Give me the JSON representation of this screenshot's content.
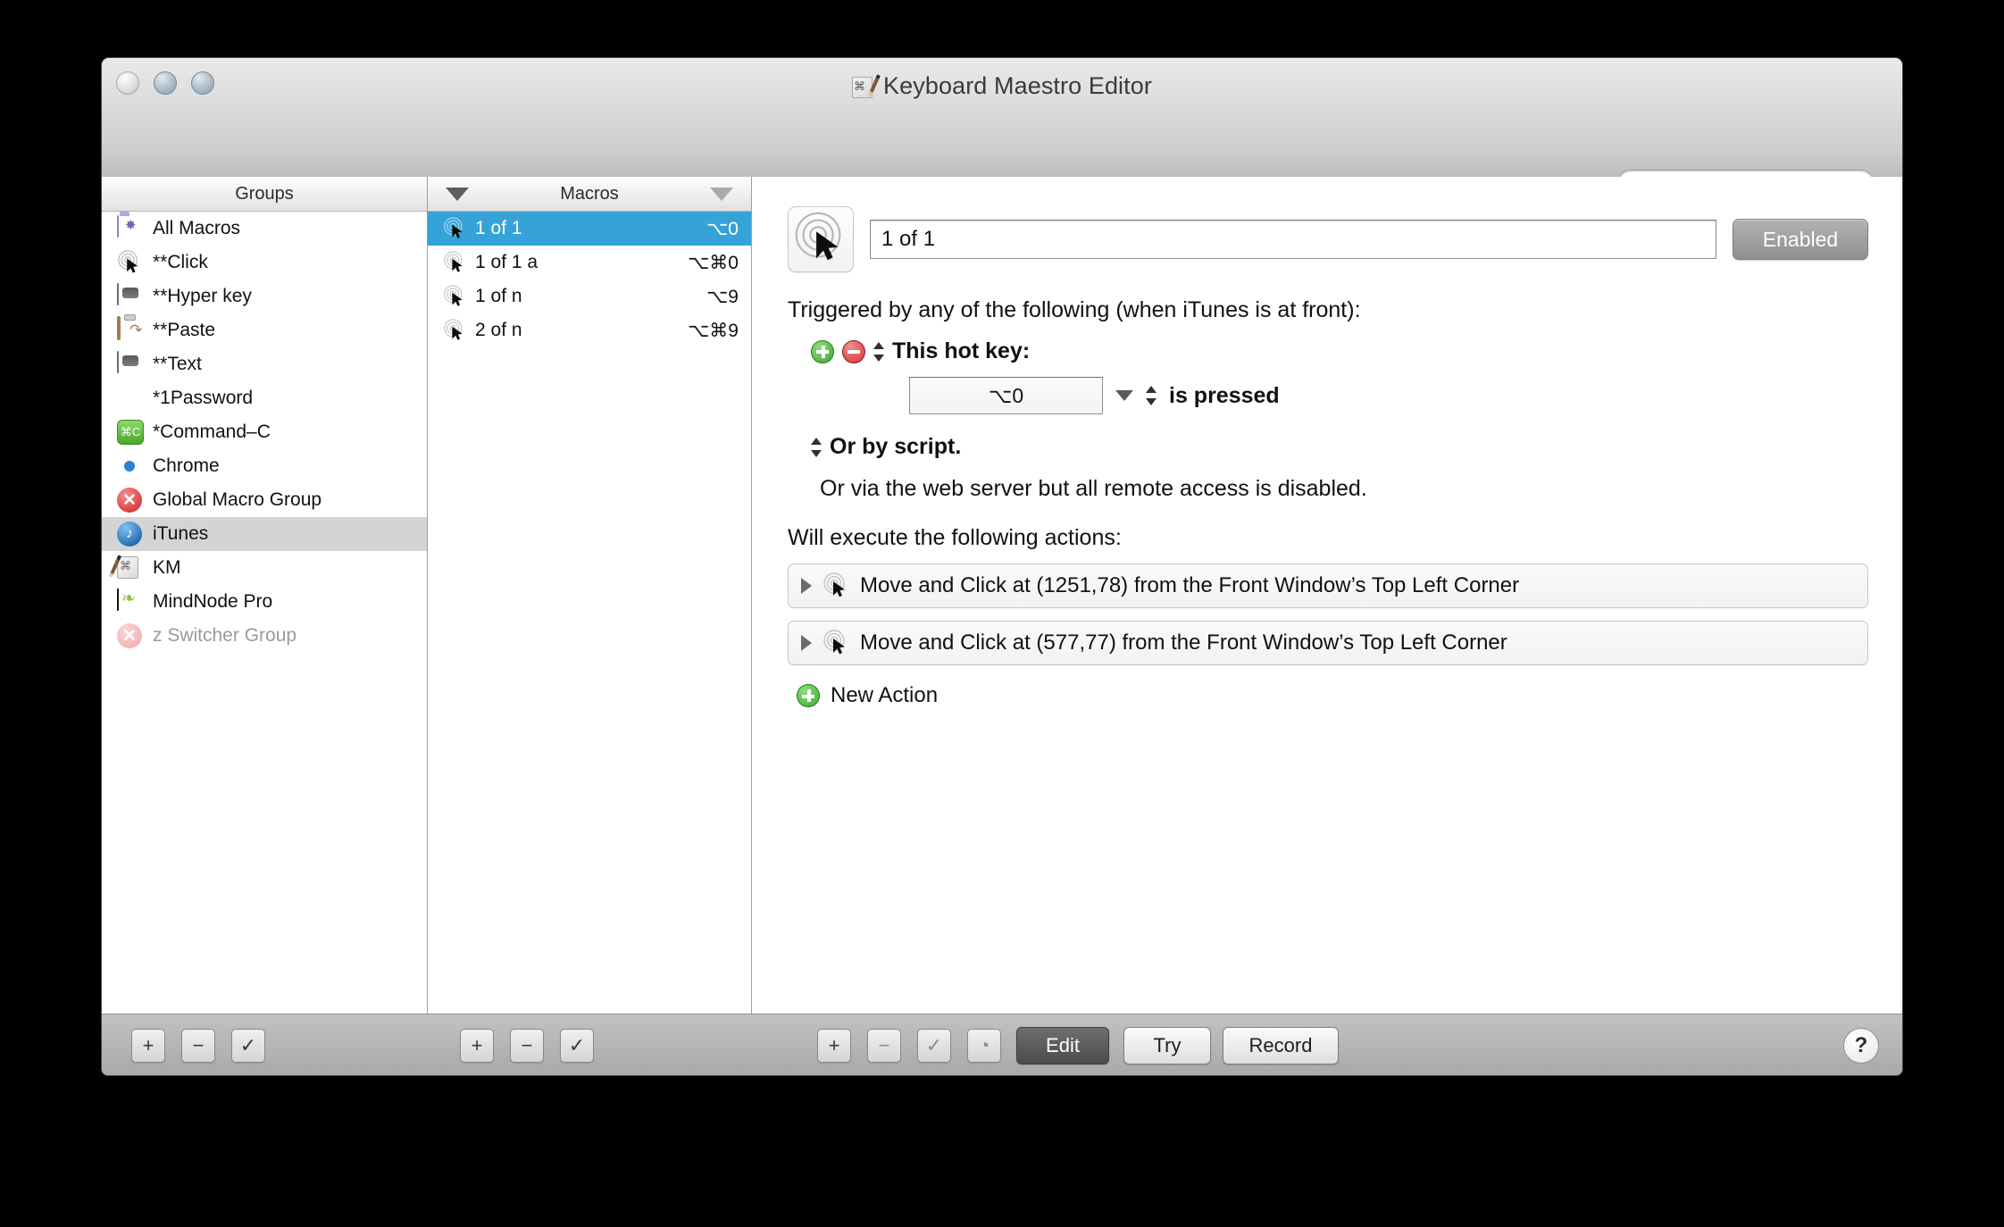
{
  "window": {
    "title": "Keyboard Maestro Editor",
    "title_icon": "keyboard-maestro-icon",
    "traffic_lights": [
      "close",
      "minimize",
      "zoom"
    ]
  },
  "search": {
    "value": "",
    "placeholder": "",
    "icon": "search-icon"
  },
  "groups_panel": {
    "header": "Groups",
    "items": [
      {
        "label": "All Macros",
        "icon": "folder-gear-icon",
        "selected": false,
        "dim": false
      },
      {
        "label": "**Click",
        "icon": "click-target-icon",
        "selected": false,
        "dim": false
      },
      {
        "label": "**Hyper key",
        "icon": "keycap-icon",
        "selected": false,
        "dim": false
      },
      {
        "label": "**Paste",
        "icon": "clipboard-icon",
        "selected": false,
        "dim": false
      },
      {
        "label": "**Text",
        "icon": "keycap-icon",
        "selected": false,
        "dim": false
      },
      {
        "label": "*1Password",
        "icon": "onepassword-icon",
        "selected": false,
        "dim": false
      },
      {
        "label": "*Command–C",
        "icon": "command-c-icon",
        "selected": false,
        "dim": false
      },
      {
        "label": "Chrome",
        "icon": "chrome-icon",
        "selected": false,
        "dim": false
      },
      {
        "label": "Global Macro Group",
        "icon": "red-x-icon",
        "selected": false,
        "dim": false
      },
      {
        "label": "iTunes",
        "icon": "itunes-icon",
        "selected": true,
        "dim": false
      },
      {
        "label": "KM",
        "icon": "keyboard-maestro-icon",
        "selected": false,
        "dim": false
      },
      {
        "label": "MindNode Pro",
        "icon": "mindnode-icon",
        "selected": false,
        "dim": false
      },
      {
        "label": "z Switcher Group",
        "icon": "red-x-pale-icon",
        "selected": false,
        "dim": true
      }
    ],
    "footer_buttons": [
      {
        "name": "add-group-button",
        "glyph": "+"
      },
      {
        "name": "remove-group-button",
        "glyph": "−"
      },
      {
        "name": "enable-group-button",
        "glyph": "✓"
      }
    ]
  },
  "macros_panel": {
    "header": "Macros",
    "sort_left_icon": "sort-descending-icon",
    "sort_right_icon": "sort-ascending-outline-icon",
    "items": [
      {
        "name": "1 of 1",
        "hotkey": "⌥0",
        "icon": "click-target-icon",
        "selected": true
      },
      {
        "name": "1 of 1 a",
        "hotkey": "⌥⌘0",
        "icon": "click-target-icon",
        "selected": false
      },
      {
        "name": "1 of n",
        "hotkey": "⌥9",
        "icon": "click-target-icon",
        "selected": false
      },
      {
        "name": "2 of n",
        "hotkey": "⌥⌘9",
        "icon": "click-target-icon",
        "selected": false
      }
    ],
    "footer_buttons": [
      {
        "name": "add-macro-button",
        "glyph": "+"
      },
      {
        "name": "remove-macro-button",
        "glyph": "−"
      },
      {
        "name": "enable-macro-button",
        "glyph": "✓"
      }
    ]
  },
  "detail": {
    "macro_icon": "click-target-icon",
    "macro_name": "1 of 1",
    "enabled_label": "Enabled",
    "trigger_heading": "Triggered by any of the following (when iTunes is at front):",
    "trigger": {
      "add_icon": "green-plus-icon",
      "remove_icon": "red-minus-icon",
      "type_label": "This hot key:",
      "hotkey_value": "⌥0",
      "condition_label": "is pressed"
    },
    "script_label": "Or by script.",
    "webserver_label": "Or via the web server but all remote access is disabled.",
    "actions_heading": "Will execute the following actions:",
    "actions": [
      {
        "icon": "click-target-icon",
        "text": "Move and Click at (1251,78) from the Front Window’s Top Left Corner"
      },
      {
        "icon": "click-target-icon",
        "text": "Move and Click at (577,77) from the Front Window’s Top Left Corner"
      }
    ],
    "new_action_label": "New Action",
    "new_action_icon": "green-plus-icon"
  },
  "bottom_bar": {
    "action_buttons": [
      {
        "name": "add-action-button",
        "glyph": "+",
        "faded": false
      },
      {
        "name": "remove-action-button",
        "glyph": "−",
        "faded": true
      },
      {
        "name": "enable-action-button",
        "glyph": "✓",
        "faded": true
      },
      {
        "name": "timing-action-button",
        "glyph": "◔",
        "faded": true
      }
    ],
    "mode_buttons": [
      {
        "name": "edit-button",
        "label": "Edit",
        "active": true
      },
      {
        "name": "try-button",
        "label": "Try",
        "active": false
      },
      {
        "name": "record-button",
        "label": "Record",
        "active": false
      }
    ],
    "help_label": "?"
  },
  "colors": {
    "selection_blue": "#36a3d8",
    "group_selected_gray": "#d4d4d4",
    "chrome_gray": "#b4b4b4",
    "green": "#3da431",
    "red": "#cf2f2f"
  }
}
